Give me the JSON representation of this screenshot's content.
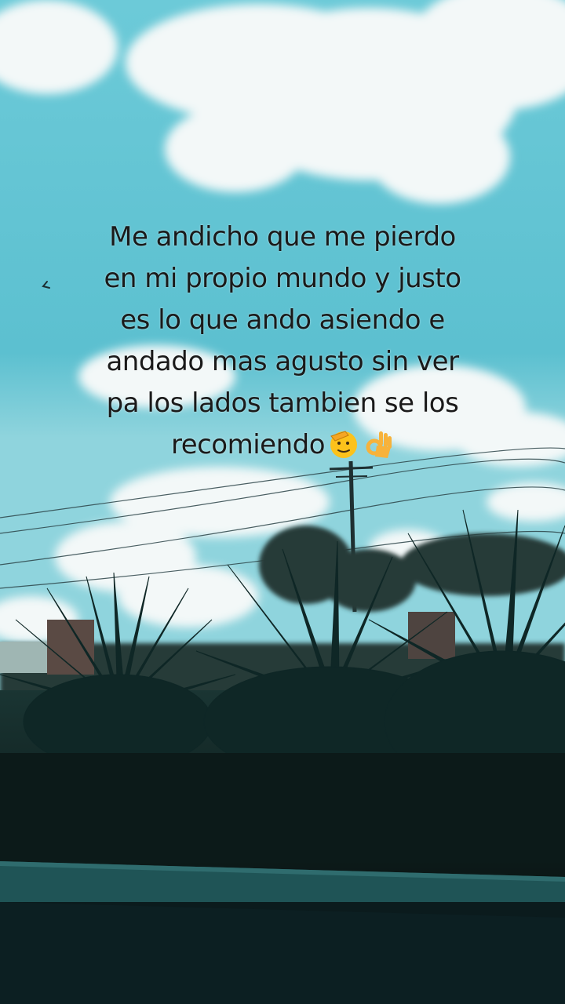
{
  "caption": {
    "lines": [
      "Me andicho que me pierdo",
      "en mi propio mundo y justo",
      "es lo que ando asiendo e",
      "andado mas agusto sin ver",
      "pa los lados tambien se los",
      "recomiendo"
    ],
    "emojis": [
      "saluting-face-emoji",
      "ok-hand-emoji"
    ]
  },
  "colors": {
    "sky": "#5fc3d3",
    "cloud": "#f2f7f7",
    "plants": "#0f2a28",
    "ledge": "#1d4d4f",
    "text": "#1a1a1a"
  }
}
